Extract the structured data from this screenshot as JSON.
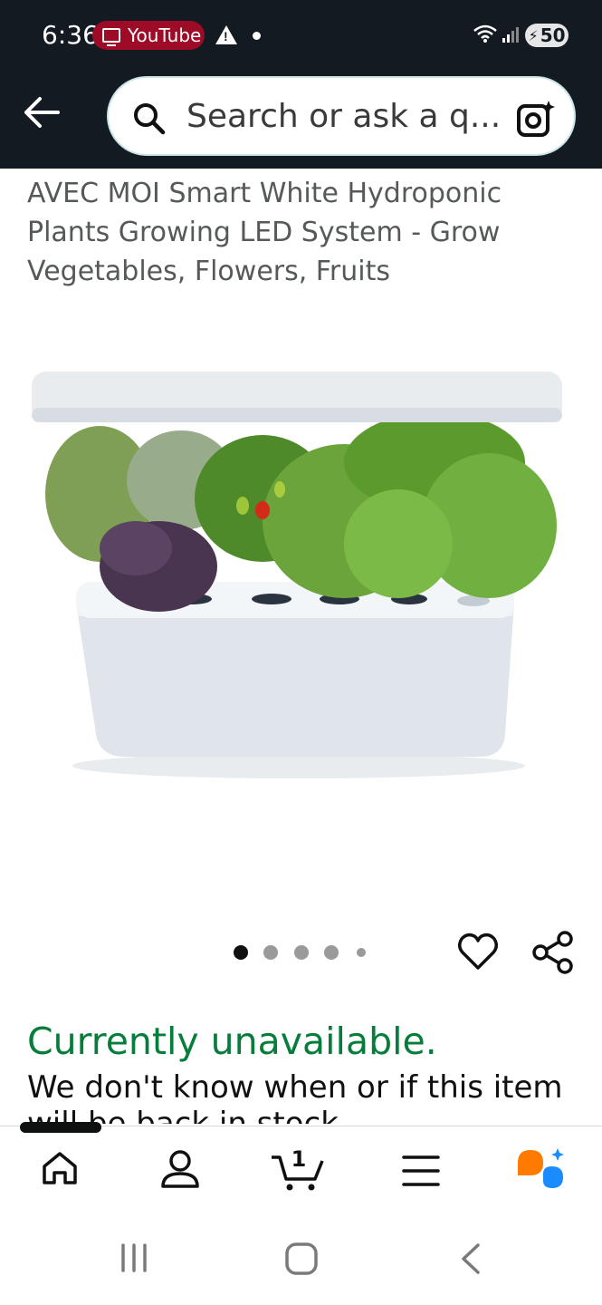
{
  "status_bar": {
    "time": "6:36",
    "notification_app": "YouTube",
    "battery_level": "50",
    "icons": [
      "tv-icon",
      "warning-icon",
      "dot-icon",
      "wifi-icon",
      "signal-icon",
      "battery-charging-icon"
    ]
  },
  "header": {
    "back_icon": "arrow-left-icon",
    "search_placeholder": "Search or ask a q...",
    "search_icon": "search-icon",
    "camera_icon": "camera-sparkle-icon"
  },
  "product": {
    "title": "AVEC MOI Smart White Hydroponic Plants Growing LED System - Grow Vegetables, Flowers, Fruits",
    "image_alt": "product-image",
    "carousel": {
      "current": 1,
      "total": 5
    },
    "availability": "Currently unavailable.",
    "availability_detail": "We don't know when or if this item will be back in stock."
  },
  "bottom_nav": {
    "items": [
      "home-icon",
      "account-icon",
      "cart-icon",
      "menu-icon",
      "rufus-icon"
    ],
    "cart_count": "1"
  },
  "colors": {
    "header_bg": "#131a22",
    "availability_green": "#067d3a",
    "badge_red": "#9e0b26"
  }
}
